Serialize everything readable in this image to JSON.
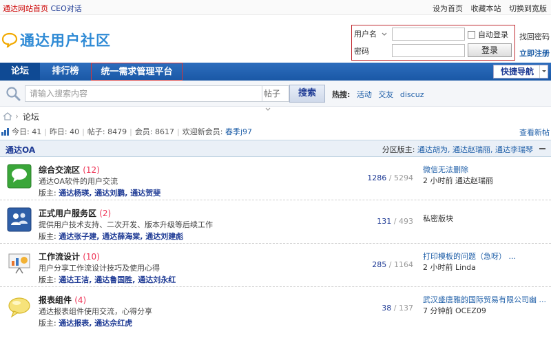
{
  "topbar": {
    "site_home": "通达网站首页",
    "ceo_talk": "CEO对话",
    "set_home": "设为首页",
    "favorite": "收藏本站",
    "switch_width": "切换到宽版"
  },
  "header": {
    "logo_text": "通达用户社区",
    "login": {
      "username_label": "用户名",
      "password_label": "密码",
      "auto_login": "自动登录",
      "login_button": "登录",
      "forgot_password": "找回密码",
      "register": "立即注册"
    }
  },
  "nav": {
    "items": [
      {
        "label": "论坛"
      },
      {
        "label": "排行榜"
      },
      {
        "label": "统一需求管理平台"
      }
    ],
    "quick_nav": "快捷导航"
  },
  "search": {
    "placeholder": "请输入搜索内容",
    "type_selected": "帖子",
    "button": "搜索",
    "hot_label": "热搜:",
    "hot_terms": [
      "活动",
      "交友",
      "discuz"
    ]
  },
  "breadcrumb": {
    "separator": "›",
    "current": "论坛"
  },
  "stats": {
    "today_label": "今日:",
    "today": "41",
    "yesterday_label": "昨日:",
    "yesterday": "40",
    "posts_label": "帖子:",
    "posts": "8479",
    "members_label": "会员:",
    "members": "8617",
    "welcome_label": "欢迎新会员:",
    "newest_member": "春季j97",
    "view_new": "查看新帖"
  },
  "category": {
    "title": "通达OA",
    "moderators_label": "分区版主:",
    "moderators": "通达胡为, 通达赵瑞丽, 通达李瑞琴"
  },
  "forums": [
    {
      "name": "综合交流区",
      "count": "(12)",
      "desc": "通达OA软件的用户交流",
      "mods_label": "版主:",
      "mods": "通达杨瑛, 通达刘鹏, 通达贺斐",
      "threads": "1286",
      "posts": "5294",
      "last_title": "微信无法删除",
      "last_meta": "2 小时前 通达赵瑞丽"
    },
    {
      "name": "正式用户服务区",
      "count": "(2)",
      "desc": "提供用户技术支持、二次开发、版本升级等后续工作",
      "mods_label": "版主:",
      "mods": "通达张子建, 通达薛海棠, 通达刘建彪",
      "threads": "131",
      "posts": "493",
      "last_title": "私密版块",
      "last_meta": ""
    },
    {
      "name": "工作流设计",
      "count": "(10)",
      "desc": "用户分享工作流设计技巧及使用心得",
      "mods_label": "版主:",
      "mods": "通达王洁, 通达鲁国胜, 通达刘永红",
      "threads": "285",
      "posts": "1164",
      "last_title": "打印模板的问题（急呀） ...",
      "last_meta": "2 小时前 Linda"
    },
    {
      "name": "报表组件",
      "count": "(4)",
      "desc": "通达报表组件使用交流，心得分享",
      "mods_label": "版主:",
      "mods": "通达报表, 通达佘红虎",
      "threads": "38",
      "posts": "137",
      "last_title": "武汉盛唐雅韵国际贸易有限公司幽 ...",
      "last_meta": "7 分钟前 OCEZ09"
    }
  ]
}
